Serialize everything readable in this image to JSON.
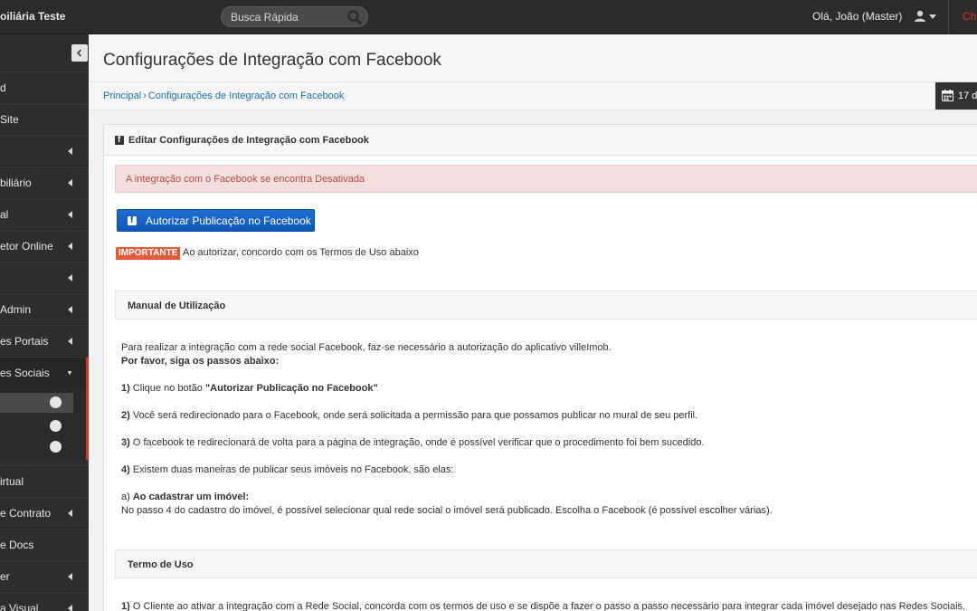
{
  "topbar": {
    "brand": "oiliária Teste",
    "search_placeholder": "Busca Rápida",
    "user_greeting": "Olá, João (Master)",
    "logout": "Ch"
  },
  "sidebar": {
    "items": [
      {
        "label": "d",
        "has_caret": false
      },
      {
        "label": "Site",
        "has_caret": false
      },
      {
        "label": "",
        "has_caret": true
      },
      {
        "label": "biliário",
        "has_caret": true
      },
      {
        "label": "al",
        "has_caret": true
      },
      {
        "label": "etor Online",
        "has_caret": true
      },
      {
        "label": "",
        "has_caret": true
      },
      {
        "label": "Admin",
        "has_caret": true
      },
      {
        "label": "es Portais",
        "has_caret": true
      },
      {
        "label": "es Sociais",
        "has_caret": true,
        "expanded": true
      },
      {
        "label": "irtual",
        "has_caret": false
      },
      {
        "label": "e Contrato",
        "has_caret": true
      },
      {
        "label": "e Docs",
        "has_caret": false
      },
      {
        "label": "er",
        "has_caret": true
      },
      {
        "label": "a Visual",
        "has_caret": true
      }
    ]
  },
  "page": {
    "title": "Configurações de Integração com Facebook",
    "breadcrumb": [
      "Principal",
      "Configurações de Integração com Facebook"
    ],
    "date": "17 d"
  },
  "portlet": {
    "title": "Editar Configurações de Integração com Facebook",
    "alert": "A integração com o Facebook se encontra Desativada",
    "auth_button": "Autorizar Publicação no Facebook",
    "important_label": "IMPORTANTE",
    "important_text": "Ao autorizar, concordo com os Termos de Uso abaixo",
    "manual": {
      "title": "Manual de Utilização",
      "intro": "Para realizar a integração com a rede social Facebook, faz-se necessário a autorização do aplicativo villeImob.",
      "follow": "Por favor, siga os passos abaixo:",
      "step1_num": "1)",
      "step1_text": " Clique no botão ",
      "step1_bold": "\"Autorizar Publicação no Facebook\"",
      "step2_num": "2)",
      "step2_text": " Você será redirecionado para o Facebook, onde será solicitada a permissão para que possamos publicar no mural de seu perfil.",
      "step3_num": "3)",
      "step3_text": " O facebook te redirecionará de volta para a página de integração, onde é possível verificar que o procedimento foi bem sucedido.",
      "step4_num": "4)",
      "step4_text": " Existem duas maneiras de publicar seus imóveis no Facebook, são elas:",
      "a_prefix": "a) ",
      "a_bold": "Ao cadastrar um imóvel:",
      "a_text": "No passo 4 do cadastro do imóvel, é possível selecionar qual rede social o imóvel será publicado. Escolha o Facebook (é possível escolher várias)."
    },
    "terms": {
      "title": "Termo de Uso",
      "t1_num": "1)",
      "t1_text": " O Cliente ao ativar a integração com a Rede Social, concorda com os termos de uso e se dispõe a fazer o passo a passo necessário para integrar cada imóvel desejado nas Redes Sociais."
    }
  }
}
